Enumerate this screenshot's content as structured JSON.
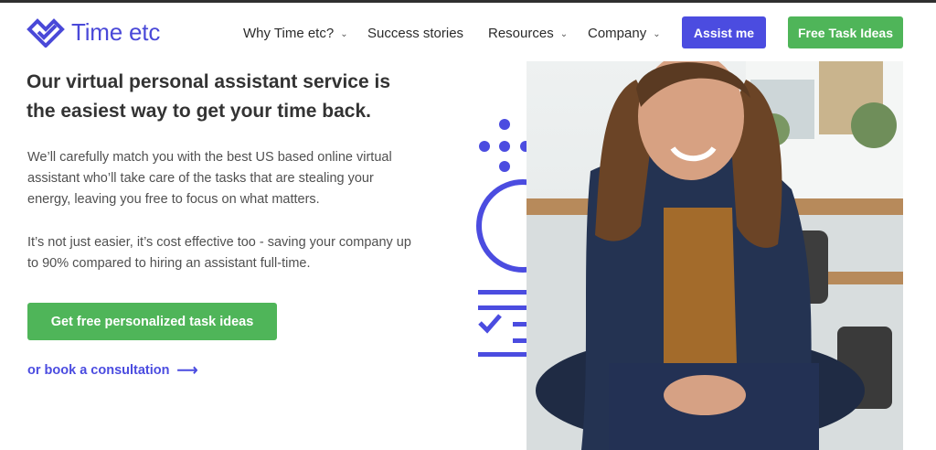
{
  "brand": {
    "name": "Time etc",
    "logo_icon": "heart-check-logo-icon",
    "accent": "#4b4ce0",
    "green": "#4fb559"
  },
  "nav": {
    "why": "Why Time etc?",
    "success": "Success stories",
    "resources": "Resources",
    "company": "Company",
    "chevron_icon": "chevron-down-icon"
  },
  "header_buttons": {
    "assist": "Assist me",
    "free": "Free Task Ideas"
  },
  "hero": {
    "headline": "Our virtual personal assistant service is the easiest way to get your time back.",
    "para1": "We’ll carefully match you with the best US based online virtual assistant who’ll take care of the tasks that are stealing your energy, leaving you free to focus on what matters.",
    "para2": "It’s not just easier, it’s cost effective too - saving your company up to 90% compared to hiring an assistant full-time.",
    "cta": "Get free personalized task ideas",
    "consult": "or book a consultation",
    "consult_arrow": "⟶"
  },
  "media": {
    "graphic_icon": "task-checklist-graphic",
    "photo": "smiling-woman-office-photo"
  }
}
